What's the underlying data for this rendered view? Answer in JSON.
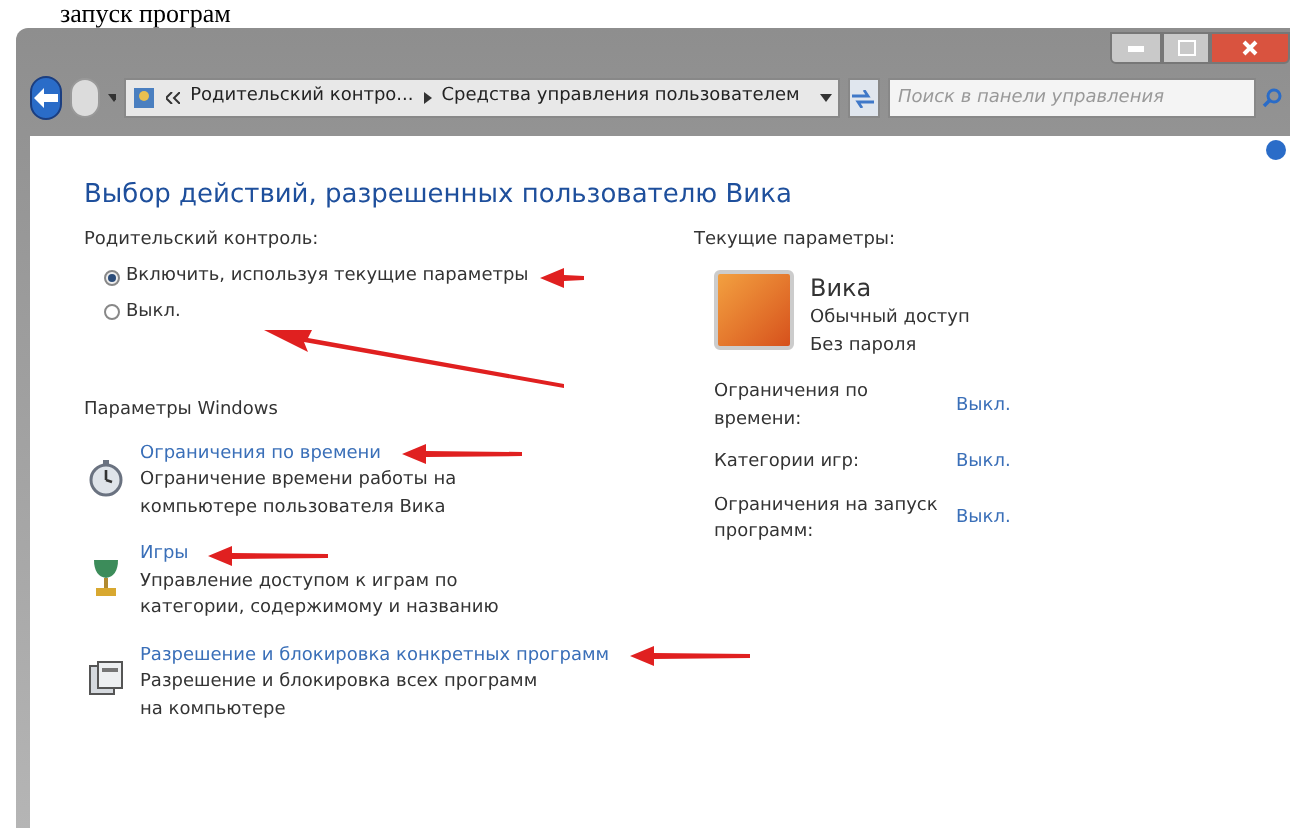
{
  "caption": "запуск програм",
  "address_bar": {
    "breadcrumbs": [
      "Родительский контро...",
      "Средства управления пользователем"
    ]
  },
  "search": {
    "placeholder": "Поиск в панели управления"
  },
  "heading": "Выбор действий, разрешенных пользователю Вика",
  "parental_control": {
    "label": "Родительский контроль:",
    "options": [
      {
        "label": "Включить, используя текущие параметры",
        "selected": true
      },
      {
        "label": "Выкл.",
        "selected": false
      }
    ]
  },
  "windows_settings": {
    "label": "Параметры Windows",
    "items": [
      {
        "kind": "clock",
        "link": "Ограничения по времени",
        "description": "Ограничение времени работы на компьютере пользователя Вика"
      },
      {
        "kind": "trophy",
        "link": "Игры",
        "description": "Управление доступом к играм по категории, содержимому и названию"
      },
      {
        "kind": "program",
        "link": "Разрешение и блокировка конкретных программ",
        "description": "Разрешение и блокировка всех программ на компьютере"
      }
    ]
  },
  "current_settings": {
    "label": "Текущие параметры:",
    "user": {
      "name": "Вика",
      "lines": [
        "Обычный доступ",
        "Без пароля"
      ]
    },
    "rows": [
      {
        "label": "Ограничения по времени:",
        "value": "Выкл."
      },
      {
        "label": "Категории игр:",
        "value": "Выкл."
      },
      {
        "label": "Ограничения на запуск программ:",
        "value": "Выкл."
      }
    ]
  }
}
